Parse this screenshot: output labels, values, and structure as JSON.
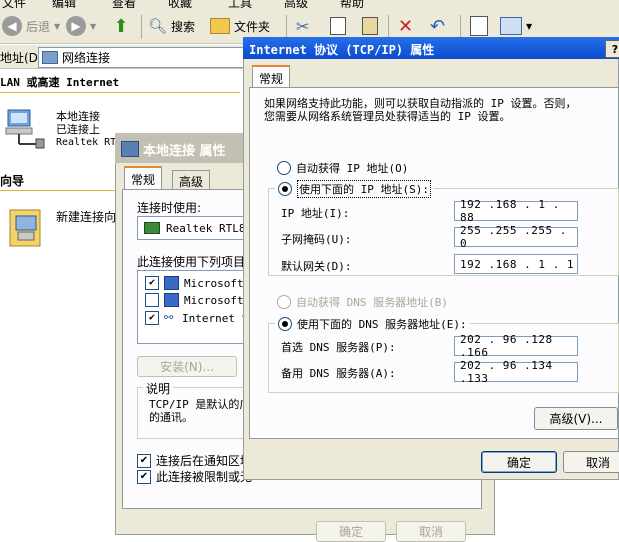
{
  "menubar": {
    "items": [
      "文件",
      "编辑",
      "查看",
      "收藏",
      "工具",
      "高级",
      "帮助"
    ]
  },
  "toolbar": {
    "back": "后退",
    "forward": "",
    "search": "搜索",
    "folders": "文件夹"
  },
  "addressbar": {
    "label": "地址(D)",
    "value": "网络连接"
  },
  "explorer": {
    "lan_header": "LAN 或高速 Internet",
    "connection": {
      "name": "本地连接",
      "status": "已连接上",
      "device": "Realtek RTL"
    },
    "wizard_header": "向导",
    "wizard_item": "新建连接向"
  },
  "local_props": {
    "title": "本地连接 属性",
    "tabs": [
      "常规",
      "高级"
    ],
    "connect_using_label": "连接时使用:",
    "adapter": "Realtek RTL81",
    "items_label": "此连接使用下列项目",
    "items": [
      {
        "label": "Microsoft F",
        "checked": true
      },
      {
        "label": "Microsoft F",
        "checked": false
      },
      {
        "label": "Internet 协",
        "checked": true
      }
    ],
    "install_button": "安装(N)...",
    "description_title": "说明",
    "description_text": "TCP/IP 是默认的广\n的通讯。",
    "show_icon_checkbox": {
      "label": "连接后在通知区域",
      "checked": true
    },
    "notify_checkbox": {
      "label": "此连接被限制或无",
      "checked": true
    },
    "ok_button": "确定",
    "cancel_button": "取消"
  },
  "tcpip": {
    "title": "Internet 协议 (TCP/IP) 属性",
    "help_button": "?",
    "tab": "常规",
    "description": "如果网络支持此功能，则可以获取自动指派的 IP 设置。否则，\n您需要从网络系统管理员处获得适当的 IP 设置。",
    "auto_ip_radio": {
      "label": "自动获得 IP 地址(O)",
      "checked": false
    },
    "manual_ip_radio": {
      "label": "使用下面的 IP 地址(S):",
      "checked": true
    },
    "ip_address_label": "IP 地址(I):",
    "ip_address": "192 .168 . 1  . 88",
    "subnet_label": "子网掩码(U):",
    "subnet": "255 .255 .255 . 0",
    "gateway_label": "默认网关(D):",
    "gateway": "192 .168 . 1  . 1",
    "auto_dns_radio": {
      "label": "自动获得 DNS 服务器地址(B)",
      "checked": false,
      "disabled": true
    },
    "manual_dns_radio": {
      "label": "使用下面的 DNS 服务器地址(E):",
      "checked": true
    },
    "preferred_dns_label": "首选 DNS 服务器(P):",
    "preferred_dns": "202 . 96 .128 .166",
    "alternate_dns_label": "备用 DNS 服务器(A):",
    "alternate_dns": "202 . 96 .134 .133",
    "advanced_button": "高级(V)...",
    "ok_button": "确定",
    "cancel_button": "取消"
  },
  "colors": {
    "titlebar_active": "#0a4ad0",
    "titlebar_inactive": "#c2bfb3",
    "dialog_bg": "#ece9d8",
    "tab_accent": "#e68b2c"
  }
}
